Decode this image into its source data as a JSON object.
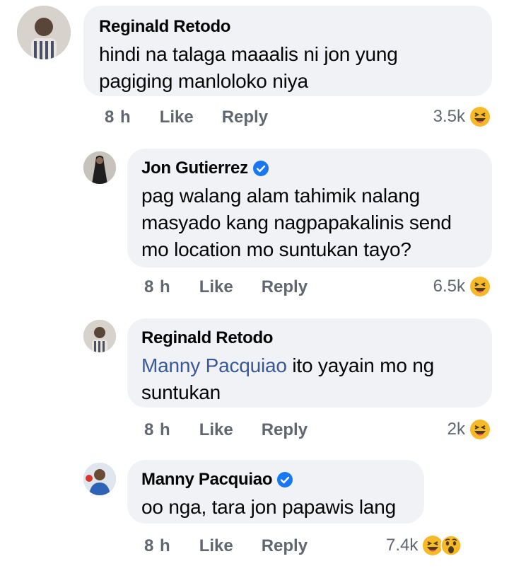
{
  "comments": [
    {
      "author": "Reginald Retodo",
      "verified": false,
      "text": "hindi na talaga maaalis ni jon yung pagiging manloloko niya",
      "time": "8 h",
      "like_label": "Like",
      "reply_label": "Reply",
      "reaction_count": "3.5k",
      "reactions": [
        "haha-icon"
      ]
    },
    {
      "author": "Jon Gutierrez",
      "verified": true,
      "text": "pag walang alam tahimik nalang masyado kang nagpapakalinis send mo location mo suntukan tayo?",
      "time": "8 h",
      "like_label": "Like",
      "reply_label": "Reply",
      "reaction_count": "6.5k",
      "reactions": [
        "haha-icon"
      ]
    },
    {
      "author": "Reginald Retodo",
      "verified": false,
      "mention": "Manny Pacquiao",
      "text": " ito yayain mo ng suntukan",
      "time": "8 h",
      "like_label": "Like",
      "reply_label": "Reply",
      "reaction_count": "2k",
      "reactions": [
        "haha-icon"
      ]
    },
    {
      "author": "Manny Pacquiao",
      "verified": true,
      "text": "oo nga, tara jon papawis lang",
      "time": "8 h",
      "like_label": "Like",
      "reply_label": "Reply",
      "reaction_count": "7.4k",
      "reactions": [
        "haha-icon",
        "wow-icon"
      ]
    }
  ],
  "colors": {
    "bubble": "#f0f2f5",
    "meta_text": "#606770",
    "mention": "#385898",
    "verified": "#1877f2",
    "emoji_yellow": "#f7b928"
  }
}
